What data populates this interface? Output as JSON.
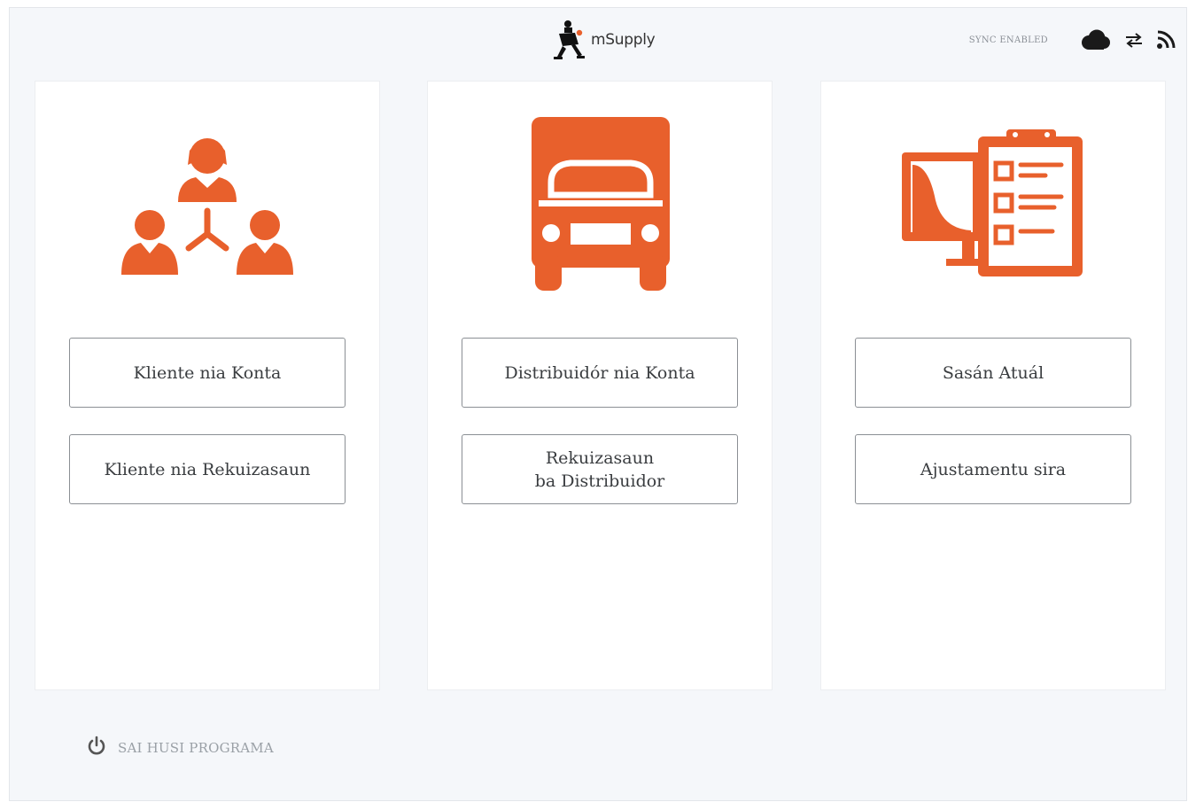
{
  "header": {
    "logo_text": "mSupply",
    "sync_status": "SYNC ENABLED",
    "icons": [
      "cloud-icon",
      "sync-arrows-icon",
      "rss-icon"
    ]
  },
  "panels": [
    {
      "icon": "customers-network-icon",
      "buttons": [
        {
          "label": "Kliente nia Konta"
        },
        {
          "label": "Kliente nia Rekuizasaun"
        }
      ]
    },
    {
      "icon": "truck-icon",
      "buttons": [
        {
          "label": "Distribuidór nia Konta"
        },
        {
          "label": "Rekuizasaun\nba Distribuidor"
        }
      ]
    },
    {
      "icon": "stocktake-clipboard-icon",
      "buttons": [
        {
          "label": "Sasán Atuál"
        },
        {
          "label": "Ajustamentu sira"
        }
      ]
    }
  ],
  "footer": {
    "exit_label": "SAI HUSI PROGRAMA",
    "icon": "power-icon"
  },
  "colors": {
    "accent": "#e8602c",
    "background": "#f5f7fa",
    "panel": "#ffffff",
    "text": "#3a3d40",
    "muted": "#9aa0a6"
  }
}
